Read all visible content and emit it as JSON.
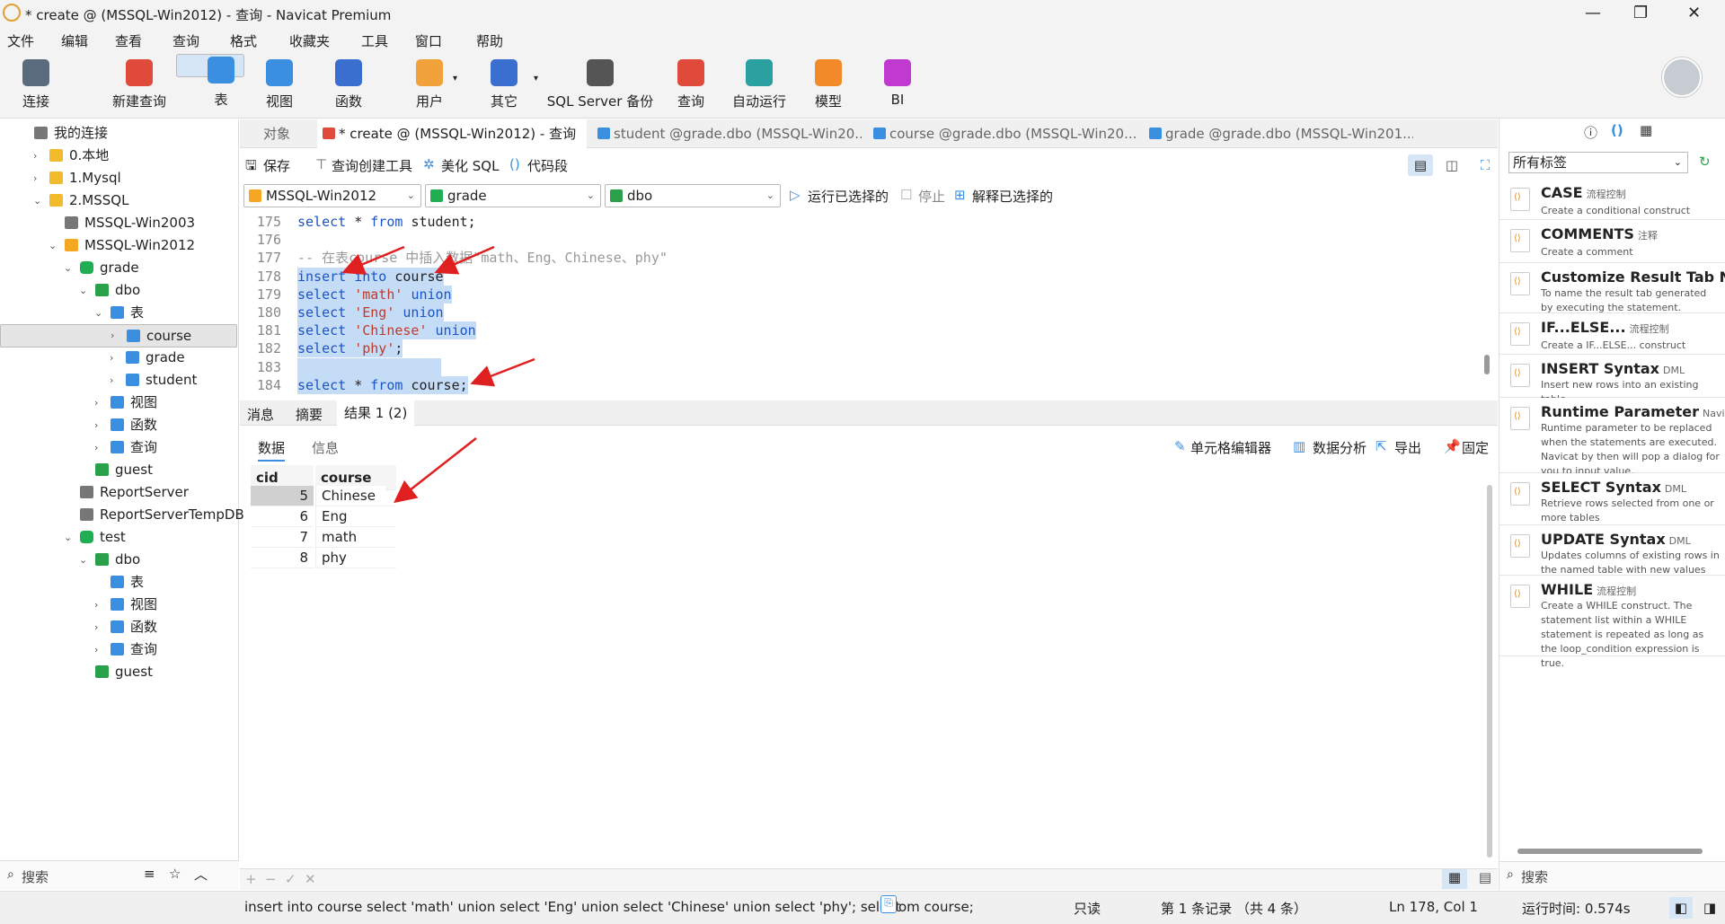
{
  "window": {
    "title": "* create @ (MSSQL-Win2012) - 查询 - Navicat Premium",
    "minimize": "—",
    "maximize": "❐",
    "close": "✕"
  },
  "menu": [
    "文件",
    "编辑",
    "查看",
    "查询",
    "格式",
    "收藏夹",
    "工具",
    "窗口",
    "帮助"
  ],
  "toolbar": [
    {
      "label": "连接",
      "icon": "connect-icon",
      "color": "#5a6b7d"
    },
    {
      "label": "新建查询",
      "icon": "new-query-icon",
      "color": "#e04a3a"
    },
    {
      "label": "表",
      "icon": "table-icon",
      "color": "#3a8fe0"
    },
    {
      "label": "视图",
      "icon": "view-icon",
      "color": "#3a8fe0"
    },
    {
      "label": "函数",
      "icon": "function-icon",
      "color": "#3a6fd0"
    },
    {
      "label": "用户",
      "icon": "user-icon",
      "color": "#f2a23a"
    },
    {
      "label": "其它",
      "icon": "tools-icon",
      "color": "#3a6fd0"
    },
    {
      "label": "SQL Server 备份",
      "icon": "backup-icon",
      "color": "#555"
    },
    {
      "label": "查询",
      "icon": "query-icon",
      "color": "#e04a3a"
    },
    {
      "label": "自动运行",
      "icon": "robot-icon",
      "color": "#2aa0a0"
    },
    {
      "label": "模型",
      "icon": "model-icon",
      "color": "#f28a2a"
    },
    {
      "label": "BI",
      "icon": "bi-icon",
      "color": "#c03ad0"
    }
  ],
  "tree": [
    {
      "label": "我的连接",
      "type": "root"
    },
    {
      "label": "0.本地",
      "type": "folder",
      "arrow": "›"
    },
    {
      "label": "1.Mysql",
      "type": "folder",
      "arrow": "›"
    },
    {
      "label": "2.MSSQL",
      "type": "folder",
      "arrow": "⌄"
    },
    {
      "label": "MSSQL-Win2003",
      "type": "server"
    },
    {
      "label": "MSSQL-Win2012",
      "type": "server-open",
      "arrow": "⌄"
    },
    {
      "label": "grade",
      "type": "db",
      "arrow": "⌄"
    },
    {
      "label": "dbo",
      "type": "schema",
      "arrow": "⌄"
    },
    {
      "label": "表",
      "type": "tables",
      "arrow": "⌄"
    },
    {
      "label": "course",
      "type": "table",
      "arrow": "›",
      "selected": true
    },
    {
      "label": "grade",
      "type": "table",
      "arrow": "›"
    },
    {
      "label": "student",
      "type": "table",
      "arrow": "›"
    },
    {
      "label": "视图",
      "type": "views",
      "arrow": "›"
    },
    {
      "label": "函数",
      "type": "functions",
      "arrow": "›"
    },
    {
      "label": "查询",
      "type": "queries",
      "arrow": "›"
    },
    {
      "label": "guest",
      "type": "schema"
    },
    {
      "label": "ReportServer",
      "type": "db-grey"
    },
    {
      "label": "ReportServerTempDB",
      "type": "db-grey"
    },
    {
      "label": "test",
      "type": "db",
      "arrow": "⌄"
    },
    {
      "label": "dbo",
      "type": "schema",
      "arrow": "⌄"
    },
    {
      "label": "表",
      "type": "tables"
    },
    {
      "label": "视图",
      "type": "views",
      "arrow": "›"
    },
    {
      "label": "函数",
      "type": "functions",
      "arrow": "›"
    },
    {
      "label": "查询",
      "type": "queries",
      "arrow": "›"
    },
    {
      "label": "guest",
      "type": "schema"
    }
  ],
  "left_search": {
    "placeholder": "搜索"
  },
  "tabs": [
    {
      "label": "对象"
    },
    {
      "label": "* create @ (MSSQL-Win2012) - 查询"
    },
    {
      "label": "student @grade.dbo (MSSQL-Win20..."
    },
    {
      "label": "course @grade.dbo (MSSQL-Win20..."
    },
    {
      "label": "grade @grade.dbo (MSSQL-Win201..."
    }
  ],
  "query_toolbar": {
    "save": "保存",
    "builder": "查询创建工具",
    "beautify": "美化 SQL",
    "snippet": "代码段"
  },
  "selectors": {
    "connection": "MSSQL-Win2012",
    "database": "grade",
    "schema": "dbo",
    "run": "运行已选择的",
    "stop": "停止",
    "explain": "解释已选择的"
  },
  "editor_lines": [
    {
      "no": "175",
      "code": "select * from student;"
    },
    {
      "no": "176",
      "code": ""
    },
    {
      "no": "177",
      "code": "-- 在表course 中插入数据\"math、Eng、Chinese、phy\""
    },
    {
      "no": "178",
      "code": "insert into course"
    },
    {
      "no": "179",
      "code": "select 'math' union"
    },
    {
      "no": "180",
      "code": "select 'Eng' union"
    },
    {
      "no": "181",
      "code": "select 'Chinese' union"
    },
    {
      "no": "182",
      "code": "select 'phy';"
    },
    {
      "no": "183",
      "code": ""
    },
    {
      "no": "184",
      "code": "select * from course;"
    }
  ],
  "result_tabs": [
    "消息",
    "摘要",
    "结果 1 (2)"
  ],
  "data_tabs": [
    "数据",
    "信息"
  ],
  "result_tools": {
    "cell_editor": "单元格编辑器",
    "analysis": "数据分析",
    "export": "导出",
    "pin": "固定"
  },
  "grid": {
    "columns": [
      "cid",
      "course"
    ],
    "rows": [
      [
        "5",
        "Chinese"
      ],
      [
        "6",
        "Eng"
      ],
      [
        "7",
        "math"
      ],
      [
        "8",
        "phy"
      ]
    ]
  },
  "bottom_controls": {
    "add": "+",
    "remove": "−",
    "confirm": "✓",
    "cancel": "✕"
  },
  "status": {
    "sql": "insert into course select 'math' union select 'Eng' union select 'Chinese' union select 'phy';  select",
    "sql_tail": "om course;",
    "readonly": "只读",
    "record": "第 1 条记录 （共 4 条）",
    "position": "Ln 178, Col 1",
    "runtime": "运行时间: 0.574s"
  },
  "right_panel": {
    "filter": "所有标签",
    "search_placeholder": "搜索",
    "snippets": [
      {
        "name": "CASE",
        "tag": "流程控制",
        "desc": "Create a conditional construct"
      },
      {
        "name": "COMMENTS",
        "tag": "注释",
        "desc": "Create a comment"
      },
      {
        "name": "Customize Result Tab Na",
        "tag": "",
        "desc": "To name the result tab generated by executing the statement."
      },
      {
        "name": "IF...ELSE...",
        "tag": "流程控制",
        "desc": "Create a IF...ELSE... construct"
      },
      {
        "name": "INSERT Syntax",
        "tag": "DML",
        "desc": "Insert new rows into an existing table"
      },
      {
        "name": "Runtime Parameter",
        "tag": "Navicat",
        "desc": "Runtime parameter to be replaced when the statements are executed. Navicat by then will pop a dialog for you to input value."
      },
      {
        "name": "SELECT Syntax",
        "tag": "DML",
        "desc": "Retrieve rows selected from one or more tables"
      },
      {
        "name": "UPDATE Syntax",
        "tag": "DML",
        "desc": "Updates columns of existing rows in the named table with new values"
      },
      {
        "name": "WHILE",
        "tag": "流程控制",
        "desc": "Create a WHILE construct. The statement list within a WHILE statement is repeated as long as the loop_condition expression is true."
      }
    ]
  }
}
